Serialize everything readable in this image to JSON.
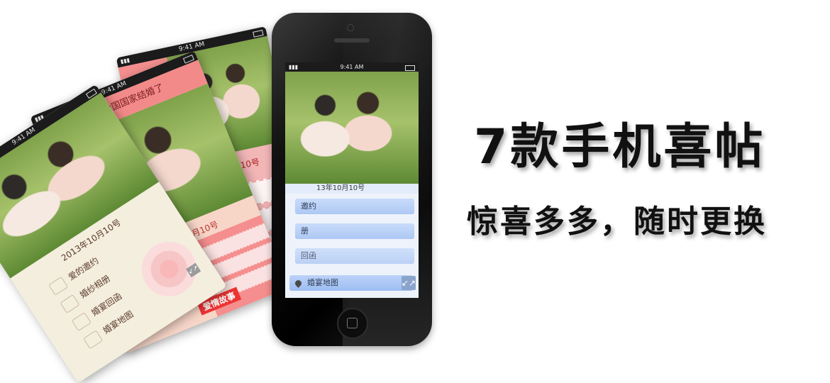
{
  "status_time": "9:41 AM",
  "card_back": {
    "date_label": "月10号"
  },
  "card_middle": {
    "banner_text": "我们结婚与中国国家结婚了",
    "date_label": "月10号",
    "footer_label": "爱情故事"
  },
  "card_front": {
    "date_label": "2013年10月10号",
    "menu": [
      "爱的邀约",
      "婚纱相册",
      "婚宴回函",
      "婚宴地图"
    ]
  },
  "phone": {
    "date_label": "13年10月10号",
    "buttons": [
      "邀约",
      "册",
      "回函",
      "婚宴地图"
    ],
    "expand_icon": "↙↗"
  },
  "headline": "7款手机喜帖",
  "subline": "惊喜多多，随时更换",
  "colors": {
    "phone_bezel": "#000000",
    "screen_bg": "#eef3fb",
    "button_blue": "#aec8f4",
    "card_rose": "#f2b6b6",
    "card_red": "#f38a8a",
    "card_beige": "#f4eede"
  }
}
